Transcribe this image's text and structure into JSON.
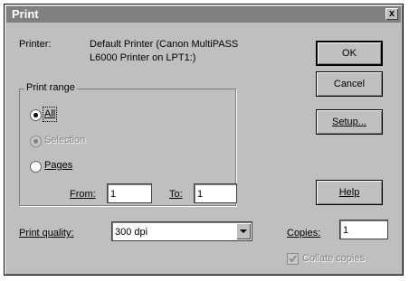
{
  "title": "Print",
  "close_glyph": "x",
  "printer": {
    "label": "Printer:",
    "name_line1": "Default Printer (Canon MultiPASS",
    "name_line2": "L6000 Printer on LPT1:)"
  },
  "buttons": {
    "ok": "OK",
    "cancel": "Cancel",
    "setup": "Setup...",
    "help": "Help"
  },
  "print_range": {
    "legend": "Print range",
    "options": [
      {
        "label": "All",
        "checked": true,
        "enabled": true
      },
      {
        "label": "Selection",
        "checked": false,
        "enabled": false
      },
      {
        "label": "Pages",
        "checked": false,
        "enabled": true
      }
    ],
    "from_label": "From:",
    "from_value": "1",
    "to_label": "To:",
    "to_value": "1"
  },
  "print_quality": {
    "label": "Print quality:",
    "value": "300 dpi"
  },
  "copies": {
    "label": "Copies:",
    "value": "1"
  },
  "collate": {
    "label": "Collate copies",
    "checked": true,
    "enabled": false
  },
  "icons": {
    "close": "close-icon",
    "dropdown": "chevron-down-icon"
  }
}
